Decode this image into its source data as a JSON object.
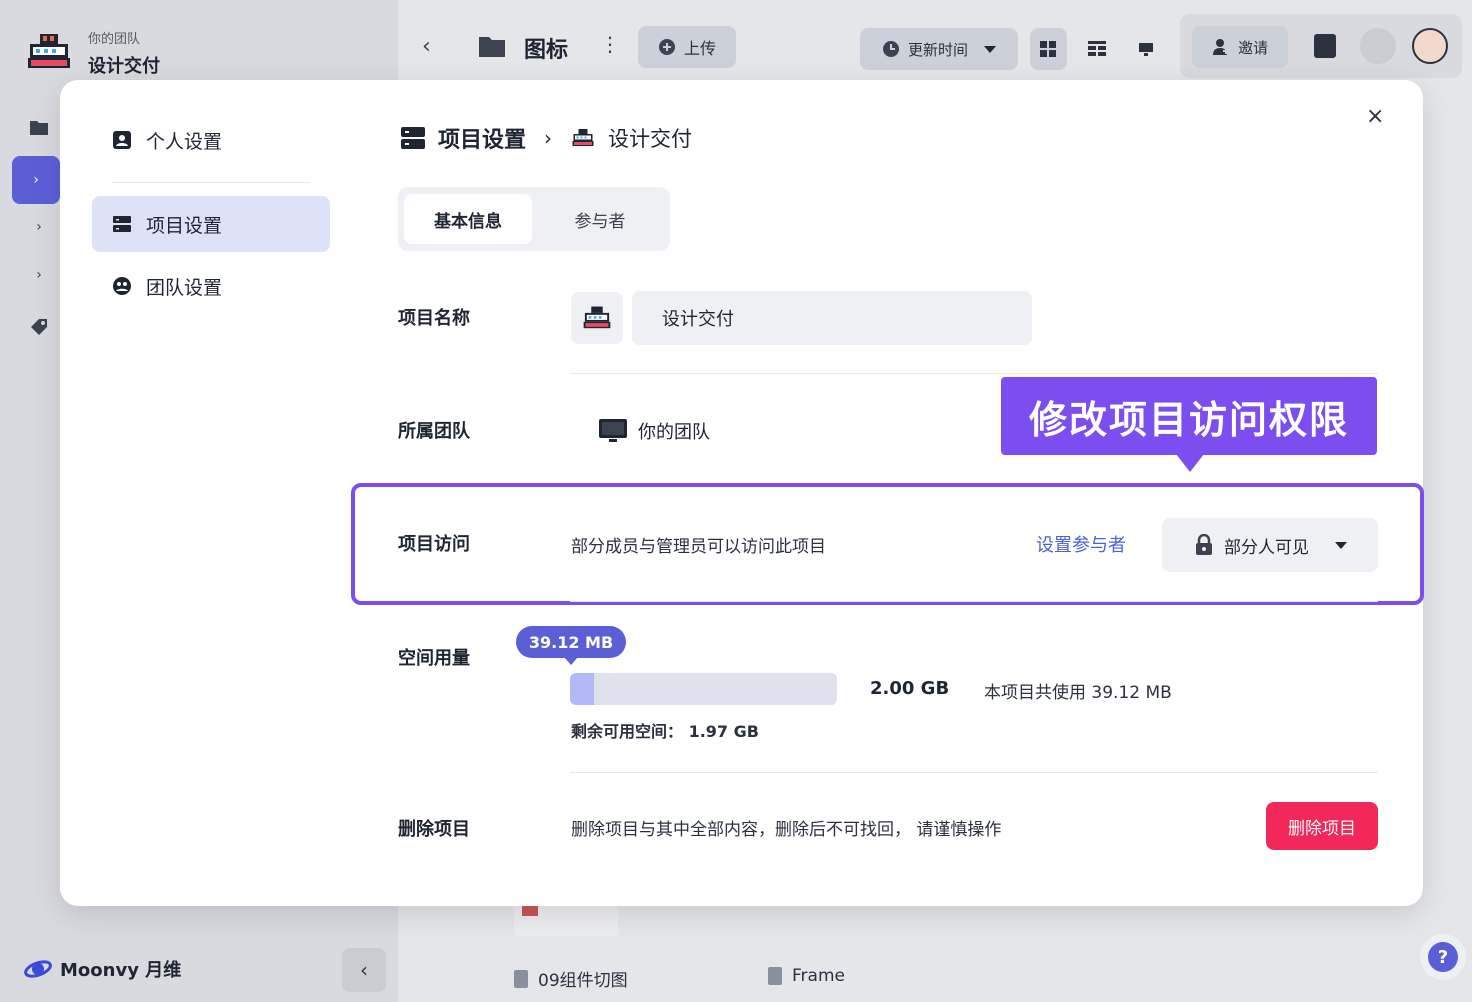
{
  "app": {
    "team_name": "你的团队",
    "project_name": "设计交付",
    "brand": "Moonvy 月维",
    "folder_title": "图标",
    "upload_label": "上传",
    "sort_label": "更新时间",
    "invite_label": "邀请",
    "files": [
      "09组件切图",
      "Frame"
    ],
    "help_label": "?"
  },
  "modal": {
    "nav": [
      {
        "label": "个人设置"
      },
      {
        "label": "项目设置"
      },
      {
        "label": "团队设置"
      }
    ],
    "breadcrumb": {
      "section": "项目设置",
      "project": "设计交付"
    },
    "tabs": [
      {
        "label": "基本信息",
        "active": true
      },
      {
        "label": "参与者",
        "active": false
      }
    ],
    "name_row": {
      "label": "项目名称",
      "value": "设计交付"
    },
    "team_row": {
      "label": "所属团队",
      "team": "你的团队"
    },
    "callout": "修改项目访问权限",
    "access_row": {
      "label": "项目访问",
      "description": "部分成员与管理员可以访问此项目",
      "link": "设置参与者",
      "selected": "部分人可见"
    },
    "usage_row": {
      "label": "空间用量",
      "used": "39.12 MB",
      "total": "2.00 GB",
      "used_text": "本项目共使用 39.12 MB",
      "remaining": "剩余可用空间： 1.97 GB",
      "used_fraction": 0.0191
    },
    "delete_row": {
      "label": "删除项目",
      "description": "删除项目与其中全部内容，删除后不可找回， 请谨慎操作",
      "button": "删除项目"
    },
    "close_label": "×"
  },
  "colors": {
    "accent": "#5b5fd6",
    "callout": "#7c4ef0",
    "danger": "#f2275a",
    "link": "#4a63d8"
  }
}
